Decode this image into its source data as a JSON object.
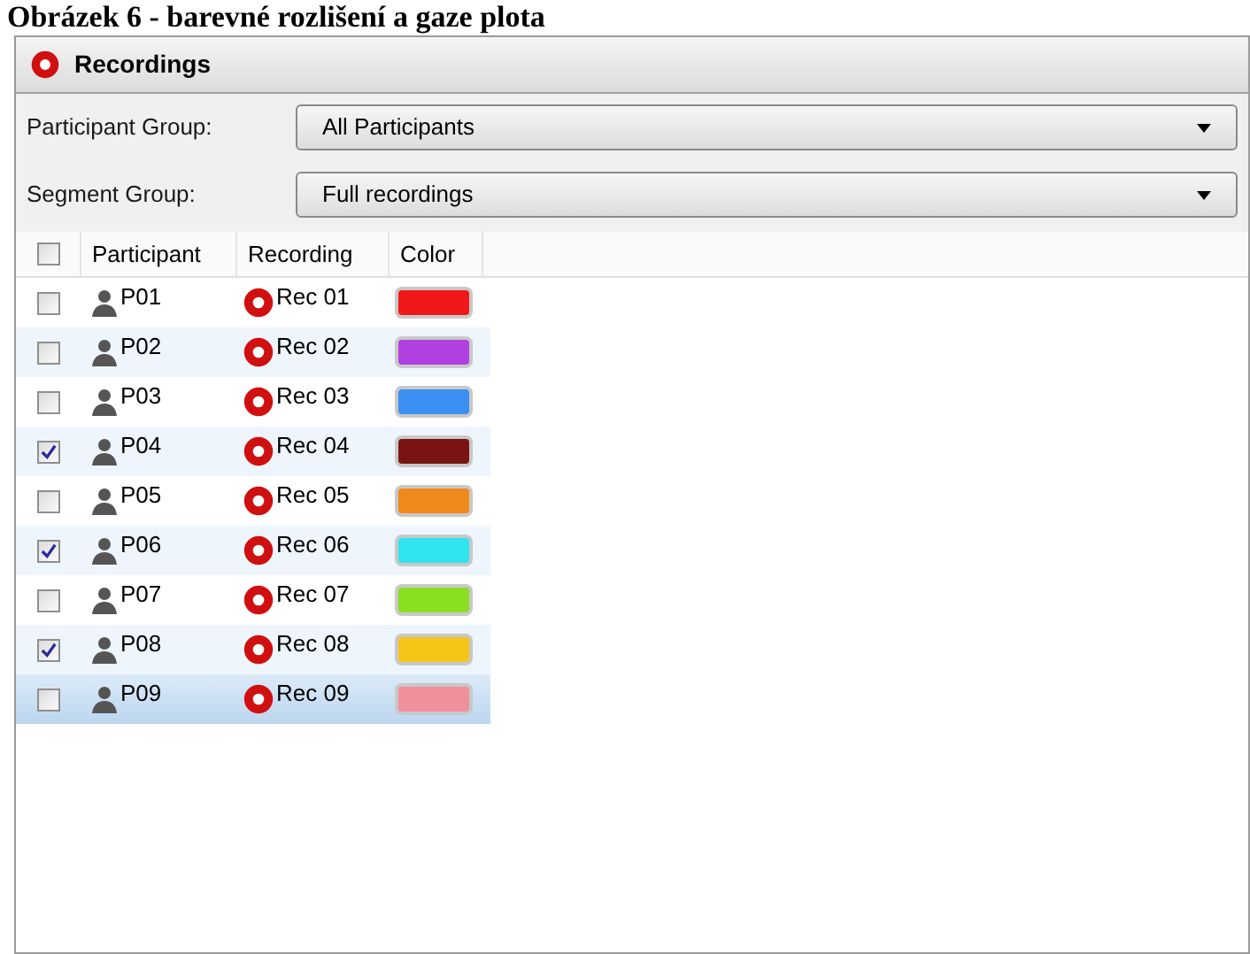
{
  "caption": "Obrázek 6 - barevné rozlišení a gaze plota",
  "window": {
    "title": "Recordings"
  },
  "filters": [
    {
      "label": "Participant Group:",
      "value": "All Participants"
    },
    {
      "label": "Segment Group:",
      "value": "Full recordings"
    }
  ],
  "table": {
    "select_all": {
      "checked": false
    },
    "columns": [
      "Participant",
      "Recording",
      "Color"
    ],
    "rows": [
      {
        "participant": "P01",
        "recording": "Rec 01",
        "color": "#f01818",
        "checked": false,
        "selected": false
      },
      {
        "participant": "P02",
        "recording": "Rec 02",
        "color": "#b040e0",
        "checked": false,
        "selected": false
      },
      {
        "participant": "P03",
        "recording": "Rec 03",
        "color": "#3a8ff0",
        "checked": false,
        "selected": false
      },
      {
        "participant": "P04",
        "recording": "Rec 04",
        "color": "#7a1414",
        "checked": true,
        "selected": false
      },
      {
        "participant": "P05",
        "recording": "Rec 05",
        "color": "#f08a1a",
        "checked": false,
        "selected": false
      },
      {
        "participant": "P06",
        "recording": "Rec 06",
        "color": "#30e4f0",
        "checked": true,
        "selected": false
      },
      {
        "participant": "P07",
        "recording": "Rec 07",
        "color": "#88e020",
        "checked": false,
        "selected": false
      },
      {
        "participant": "P08",
        "recording": "Rec 08",
        "color": "#f5c518",
        "checked": true,
        "selected": false
      },
      {
        "participant": "P09",
        "recording": "Rec 09",
        "color": "#f0909a",
        "checked": false,
        "selected": true
      }
    ]
  }
}
